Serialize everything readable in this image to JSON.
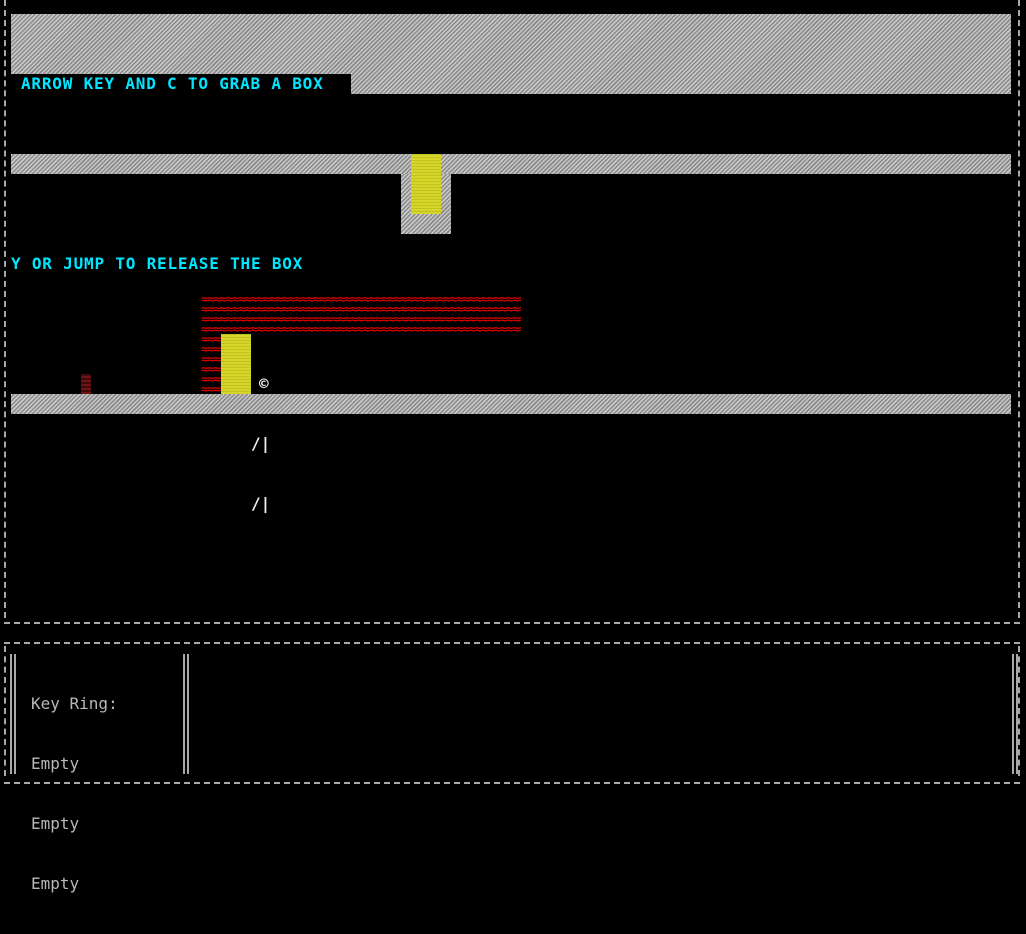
{
  "game": {
    "hints": {
      "grab": "ARROW KEY AND C TO GRAB A BOX",
      "release": "Y OR JUMP TO RELEASE THE BOX"
    },
    "player": {
      "head": "©",
      "torso": "/|",
      "legs": "/|"
    },
    "lava_glyph": "≈"
  },
  "inventory": {
    "title": "Key Ring:",
    "slots": [
      "Empty",
      "Empty",
      "Empty"
    ]
  },
  "colors": {
    "hint_text": "#00e6ff",
    "lava": "#e00000",
    "box": "#d6d62a",
    "wall": "#b4b4b4",
    "door": "#5a0f0f"
  }
}
